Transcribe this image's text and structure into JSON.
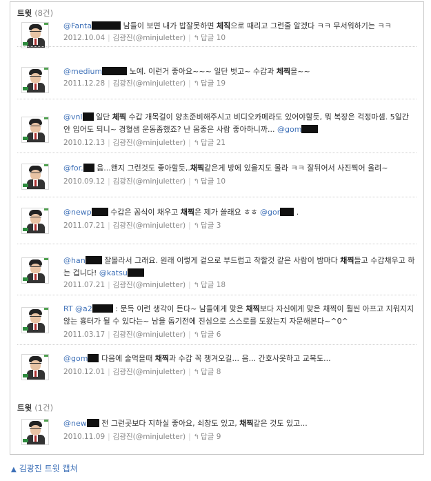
{
  "section1": {
    "title": "트윗",
    "count": "(8건)"
  },
  "section2": {
    "title": "트윗",
    "count": "(1건)"
  },
  "author": "김광진(@minjuletter)",
  "reply_label": "답글",
  "tweets": [
    {
      "mention": "@Fanta",
      "text": "남들이 보면 내가 밥잘못하면 ",
      "hl": "체직",
      "text2": "으로 때리고 그런줄 알겠다 ㅋㅋ 무서워하기는 ㅋㅋ",
      "mention2": "",
      "text3": "",
      "date": "2012.10.04",
      "replies": "10"
    },
    {
      "mention": "@medium",
      "text": "노예. 이런거 좋아요~~~ 일단 벗고~ 수갑과 ",
      "hl": "체찍",
      "text2": "을~~",
      "mention2": "",
      "text3": "",
      "date": "2011.12.28",
      "replies": "19"
    },
    {
      "mention": "@vnl",
      "text": "일단 ",
      "hl": "체찍",
      "text2": " 수갑 개목걸이 양초준비해주시고 비디오카메라도 있어야할듯, 뭐 복장은 걱정마셈. 5일간 안 입어도 되니~ 경혈샘 운동좀했죠? 난 몸좋은 사람 좋아하니까... ",
      "mention2": "@gom",
      "text3": "",
      "date": "2010.12.13",
      "replies": "21"
    },
    {
      "mention": "@for.",
      "text": "음...왠지 그런것도 좋아할듯,.",
      "hl": "채찍",
      "text2": "같은게 방에 있을지도 몰라 ㅋㅋ 잘뒤어서 사진찍어 올려~",
      "mention2": "",
      "text3": "",
      "date": "2010.09.12",
      "replies": "10"
    },
    {
      "mention": "@newp",
      "text": "수갑은 꼼식이 채우고 ",
      "hl": "채찍",
      "text2": "은 제가 쓸래요 ㅎㅎ ",
      "mention2": "@gor",
      "text3": " .",
      "date": "2011.07.21",
      "replies": "3"
    },
    {
      "mention": "@han",
      "text": "잘몰라서 그래요. 원래 이렇게 겉으로 부드럽고 착할것 같은 사람이 밤마다 ",
      "hl": "채찍",
      "text2": "들고 수갑채우고 하는 겁니다! ",
      "mention2": "@katsu",
      "text3": "",
      "date": "2011.07.21",
      "replies": "18"
    },
    {
      "mention": "RT @a2",
      "text": ": 문득 이런 생각이 든다~ 남들에게 맞은 ",
      "hl": "채찍",
      "text2": "보다 자신에게 맞은 채찍이 훨씬 아프고 지워지지 않는 흉터가 될 수 있다는~ 남을 돕기전에 진심으로 스스로를 도왔는지 자문해본다~^0^",
      "mention2": "",
      "text3": "",
      "date": "2011.03.17",
      "replies": "6"
    },
    {
      "mention": "@gom",
      "text": "다음에 술먹을때 ",
      "hl": "채찍",
      "text2": "과 수갑 꼭 챙겨오길... 음... 간호사옷하고 교복도...",
      "mention2": "",
      "text3": "",
      "date": "2010.12.01",
      "replies": "8"
    },
    {
      "mention": "@new",
      "text": "전 그런곳보다 지하실 좋아요, 쇠창도 있고, ",
      "hl": "채찍",
      "text2": "같은 것도 있고...",
      "mention2": "",
      "text3": "",
      "date": "2010.11.09",
      "replies": "9"
    }
  ],
  "caption": "김광진 트윗 캡쳐"
}
